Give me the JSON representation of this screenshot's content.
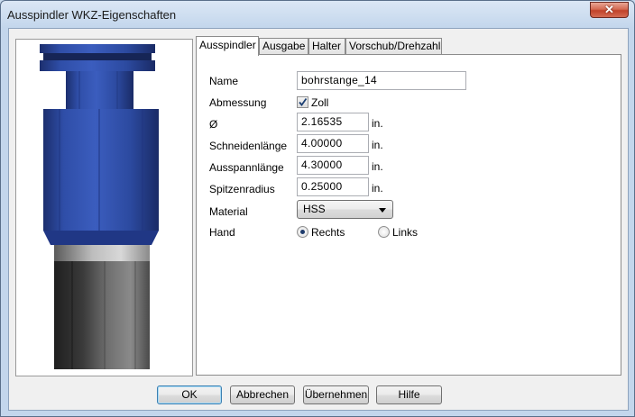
{
  "window": {
    "title": "Ausspindler WKZ-Eigenschaften",
    "close_label": "✕"
  },
  "tabs": [
    {
      "label": "Ausspindler",
      "active": true
    },
    {
      "label": "Ausgabe",
      "active": false
    },
    {
      "label": "Halter",
      "active": false
    },
    {
      "label": "Vorschub/Drehzahl",
      "active": false
    }
  ],
  "form": {
    "name": {
      "label": "Name",
      "value": "bohrstange_14"
    },
    "abmessung": {
      "label": "Abmessung",
      "checkbox_label": "Zoll",
      "checked": true
    },
    "diameter": {
      "label": "Ø",
      "value": "2.16535",
      "unit": "in."
    },
    "schneidenlaenge": {
      "label": "Schneidenlänge",
      "value": "4.00000",
      "unit": "in."
    },
    "ausspannlaenge": {
      "label": "Ausspannlänge",
      "value": "4.30000",
      "unit": "in."
    },
    "spitzenradius": {
      "label": "Spitzenradius",
      "value": "0.25000",
      "unit": "in."
    },
    "material": {
      "label": "Material",
      "selected": "HSS"
    },
    "hand": {
      "label": "Hand",
      "option_right": "Rechts",
      "option_left": "Links",
      "selected": "Rechts"
    }
  },
  "buttons": {
    "ok": "OK",
    "cancel": "Abbrechen",
    "apply": "Übernehmen",
    "help": "Hilfe"
  },
  "colors": {
    "tool_body": "#2c4aa0",
    "tool_holder_dark": "#2a2a2a",
    "tool_holder_mid": "#6b6b6b",
    "default_button_border": "#3c7fb1"
  }
}
